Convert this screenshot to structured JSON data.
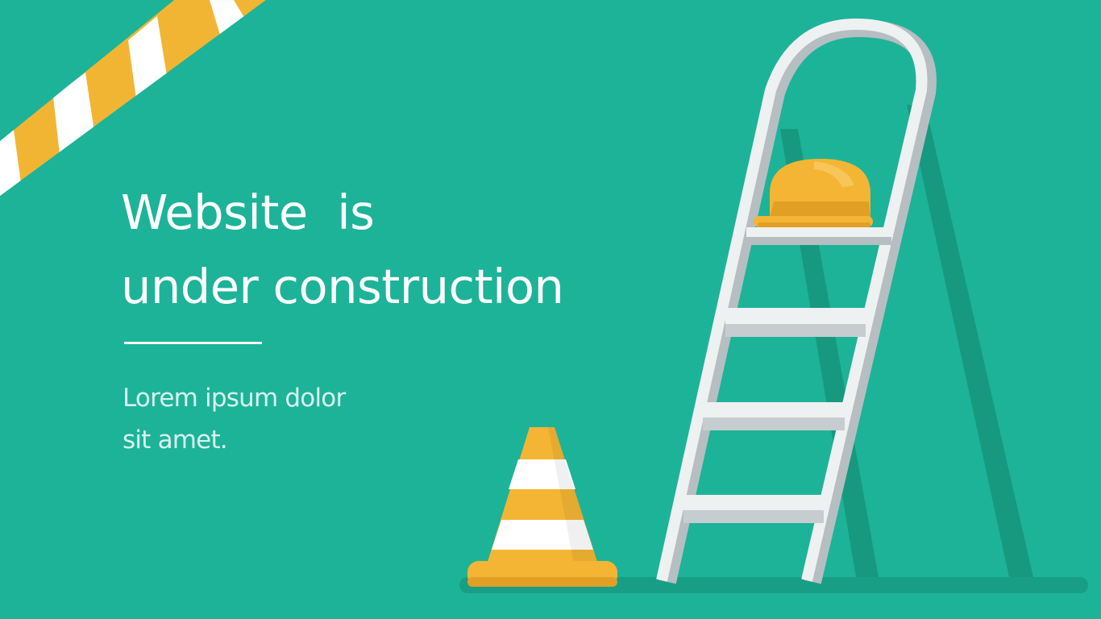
{
  "hero": {
    "title_line1": "Website  is",
    "title_line2": "under construction",
    "subtitle_line1": "Lorem ipsum dolor",
    "subtitle_line2": "sit amet."
  },
  "colors": {
    "background": "#1db399",
    "shadow": "#17997f",
    "floor": "#179e85",
    "stripe_yellow": "#f2b533",
    "stripe_white": "#ffffff",
    "ladder_light": "#eef1f2",
    "ladder_dark": "#b6bec2",
    "helmet": "#f4b534",
    "helmet_dark": "#e29f25"
  },
  "icons": {
    "tape": "caution-tape-icon",
    "cone": "traffic-cone-icon",
    "ladder": "step-ladder-icon",
    "helmet": "hard-hat-icon"
  }
}
